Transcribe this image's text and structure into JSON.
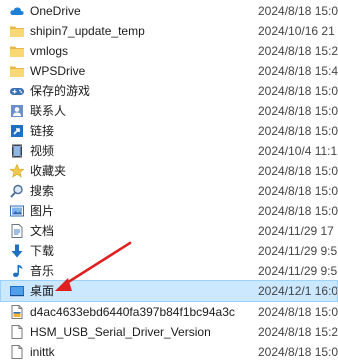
{
  "files": [
    {
      "name": "OneDrive",
      "date": "2024/8/18 15:0",
      "icon": "cloud-icon"
    },
    {
      "name": "shipin7_update_temp",
      "date": "2024/10/16 21",
      "icon": "folder-icon"
    },
    {
      "name": "vmlogs",
      "date": "2024/8/18 15:2",
      "icon": "folder-icon"
    },
    {
      "name": "WPSDrive",
      "date": "2024/8/18 15:4",
      "icon": "folder-icon"
    },
    {
      "name": "保存的游戏",
      "date": "2024/8/18 15:0",
      "icon": "saved-games-icon"
    },
    {
      "name": "联系人",
      "date": "2024/8/18 15:0",
      "icon": "contacts-icon"
    },
    {
      "name": "链接",
      "date": "2024/8/18 15:0",
      "icon": "links-icon"
    },
    {
      "name": "视频",
      "date": "2024/10/4 11:1",
      "icon": "videos-icon"
    },
    {
      "name": "收藏夹",
      "date": "2024/8/18 15:0",
      "icon": "favorites-star-icon"
    },
    {
      "name": "搜索",
      "date": "2024/8/18 15:0",
      "icon": "search-icon"
    },
    {
      "name": "图片",
      "date": "2024/8/18 15:0",
      "icon": "pictures-icon"
    },
    {
      "name": "文档",
      "date": "2024/11/29 17",
      "icon": "documents-icon"
    },
    {
      "name": "下载",
      "date": "2024/11/29 9:5",
      "icon": "downloads-icon"
    },
    {
      "name": "音乐",
      "date": "2024/11/29 9:5",
      "icon": "music-icon"
    },
    {
      "name": "桌面",
      "date": "2024/12/1 16:0",
      "icon": "desktop-icon",
      "selected": true
    },
    {
      "name": "d4ac4633ebd6440fa397b84f1bc94a3c",
      "date": "2024/8/18 15:0",
      "icon": "file-icon"
    },
    {
      "name": "HSM_USB_Serial_Driver_Version",
      "date": "2024/8/18 15:2",
      "icon": "file-icon"
    },
    {
      "name": "inittk",
      "date": "2024/8/18 15:0",
      "icon": "file-icon"
    }
  ],
  "colors": {
    "selection_background": "#cce8ff",
    "selection_border": "#99d1ff",
    "annotation_arrow": "#e02020",
    "folder_yellow": "#f8d775"
  }
}
